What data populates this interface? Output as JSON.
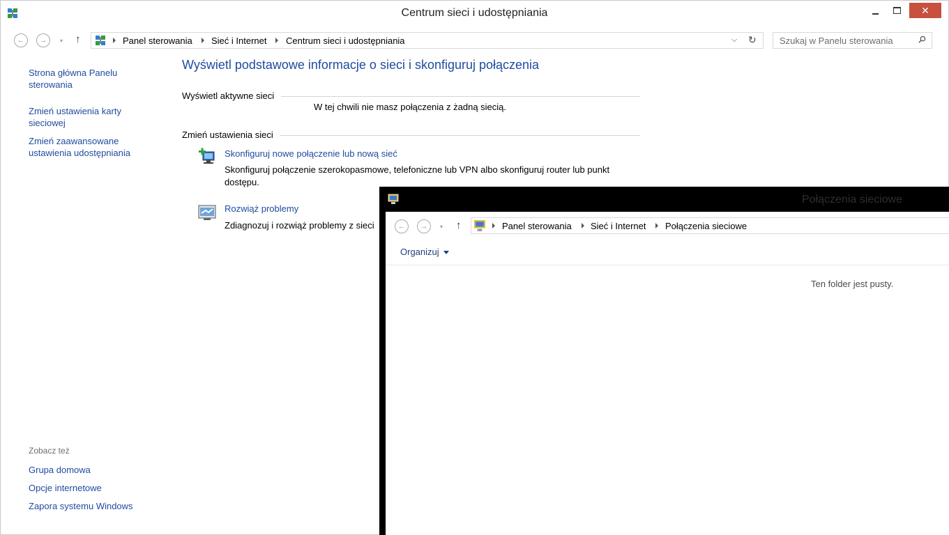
{
  "main_window": {
    "title": "Centrum sieci i udostępniania",
    "close_glyph": "✕",
    "nav": {
      "back_glyph": "←",
      "forward_glyph": "→",
      "up_glyph": "↑",
      "dropdown_glyph": "▾"
    },
    "breadcrumbs": [
      "Panel sterowania",
      "Sieć i Internet",
      "Centrum sieci i udostępniania"
    ],
    "address_dropdown_glyph": "⌵",
    "refresh_glyph": "↻",
    "search": {
      "placeholder": "Szukaj w Panelu sterowania"
    },
    "left_pane": {
      "links": [
        "Strona główna Panelu sterowania",
        "Zmień ustawienia karty sieciowej",
        "Zmień zaawansowane ustawienia udostępniania"
      ],
      "see_also_label": "Zobacz też",
      "see_also": [
        "Grupa domowa",
        "Opcje internetowe",
        "Zapora systemu Windows"
      ]
    },
    "content": {
      "heading": "Wyświetl podstawowe informacje o sieci i skonfiguruj połączenia",
      "active_networks_label": "Wyświetl aktywne sieci",
      "no_connection_text": "W tej chwili nie masz połączenia z żadną siecią.",
      "change_settings_label": "Zmień ustawienia sieci",
      "tasks": [
        {
          "title": "Skonfiguruj nowe połączenie lub nową sieć",
          "description": "Skonfiguruj połączenie szerokopasmowe, telefoniczne lub VPN albo skonfiguruj router lub punkt dostępu.",
          "icon": "new-connection-icon"
        },
        {
          "title": "Rozwiąż problemy",
          "description": "Zdiagnozuj i rozwiąż problemy z sieci",
          "icon": "troubleshoot-icon"
        }
      ]
    }
  },
  "second_window": {
    "title": "Połączenia sieciowe",
    "breadcrumbs": [
      "Panel sterowania",
      "Sieć i Internet",
      "Połączenia sieciowe"
    ],
    "toolbar": {
      "organize_label": "Organizuj"
    },
    "empty_text": "Ten folder jest pusty."
  },
  "colors": {
    "link": "#1e4b9f",
    "close_button": "#c7503e",
    "overlay_frame": "#000000"
  }
}
